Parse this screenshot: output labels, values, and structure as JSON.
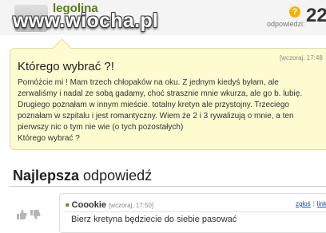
{
  "header": {
    "username": "legolina",
    "watermark": "www.wiocha.pl",
    "answers_label": "odpowiedzi:",
    "answers_count": "22",
    "hint_icon": "?"
  },
  "question": {
    "date": "[wczoraj, 17:48",
    "title": "Którego wybrać ?!",
    "lines": [
      "Pomóżcie mi ! Mam trzech chłopaków na oku. Z jednym kiedyś byłam, ale",
      "zerwaliśmy i nadal ze sobą gadamy, choć strasznie mnie wkurza, ale go b. lubię.",
      "Drugiego poznałam w innym mieście. totalny kretyn ale przystojny. Trzeciego",
      "poznałam w szpitalu i jest romantyczny. Wiem że 2 i 3 rywalizują o mnie, a ten",
      "pierwszy nic o tym nie wie (o tych pozostałych)",
      "Którego wybrać ?"
    ]
  },
  "best": {
    "title_bold": "Najlepsza",
    "title_rest": " odpowiedź"
  },
  "answer": {
    "author": "Coookie",
    "date": "[wczoraj, 17:50]",
    "link1": "zgłoś",
    "link2": "link",
    "text": "Bierz kretyna będziecie do siebie pasować"
  }
}
